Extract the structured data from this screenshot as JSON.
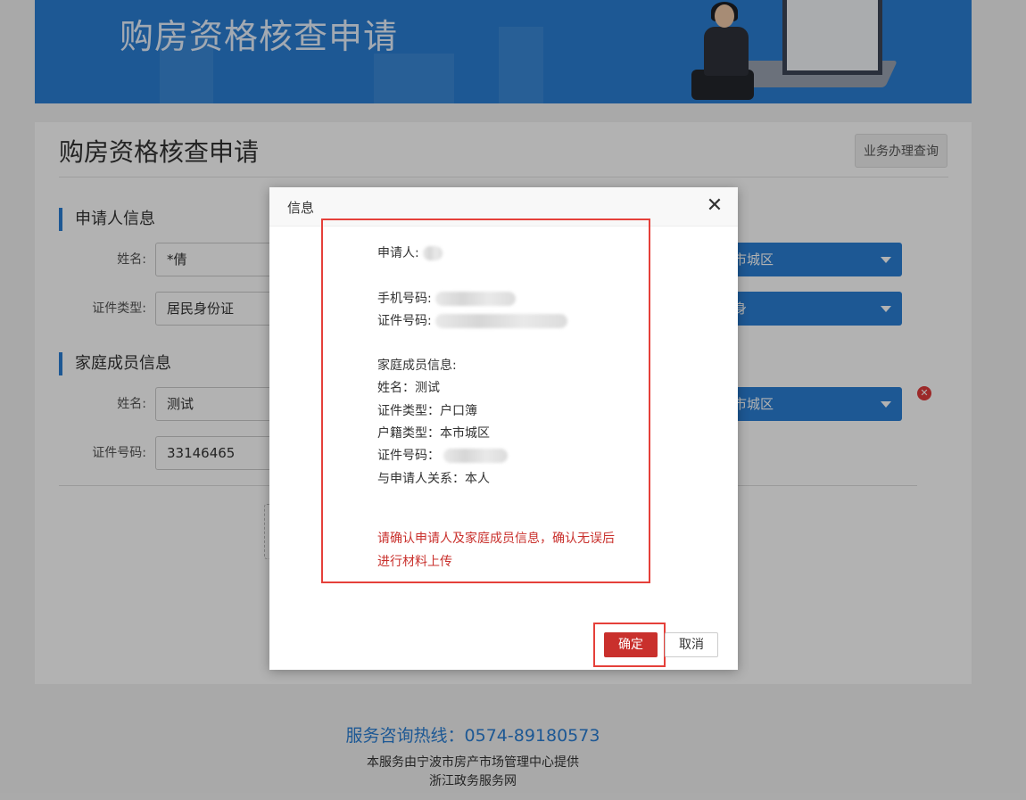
{
  "banner": {
    "title": "购房资格核查申请"
  },
  "card": {
    "title": "购房资格核查申请",
    "query_button": "业务办理查询"
  },
  "applicant_section": {
    "heading": "申请人信息",
    "name_label": "姓名:",
    "name_value": "*倩",
    "id_type_label": "证件类型:",
    "id_type_value": "居民身份证",
    "household_select": "本市城区",
    "marital_select": "单身"
  },
  "family_section": {
    "heading": "家庭成员信息",
    "name_label": "姓名:",
    "name_value": "测试",
    "id_number_label": "证件号码:",
    "id_number_value": "33146465",
    "household_select": "本市城区",
    "delete_icon": "close-circle-icon"
  },
  "footer": {
    "hotline": "服务咨询热线：0574-89180573",
    "provider": "本服务由宁波市房产市场管理中心提供",
    "site": "浙江政务服务网"
  },
  "dialog": {
    "title": "信息",
    "close_glyph": "✕",
    "applicant_label": "申请人:",
    "phone_label": "手机号码:",
    "id_number_label": "证件号码:",
    "family_heading": "家庭成员信息:",
    "member_name": "姓名：测试",
    "member_id_type": "证件类型：户口簿",
    "member_household": "户籍类型：本市城区",
    "member_id_number_label": "证件号码：",
    "member_relation": "与申请人关系：本人",
    "warning_line1": "请确认申请人及家庭成员信息，确认无误后",
    "warning_line2": "进行材料上传",
    "confirm_button": "确定",
    "cancel_button": "取消"
  },
  "colors": {
    "brand_blue": "#2a7fd4",
    "confirm_red": "#c9302c",
    "highlight_red": "#e5403a"
  }
}
